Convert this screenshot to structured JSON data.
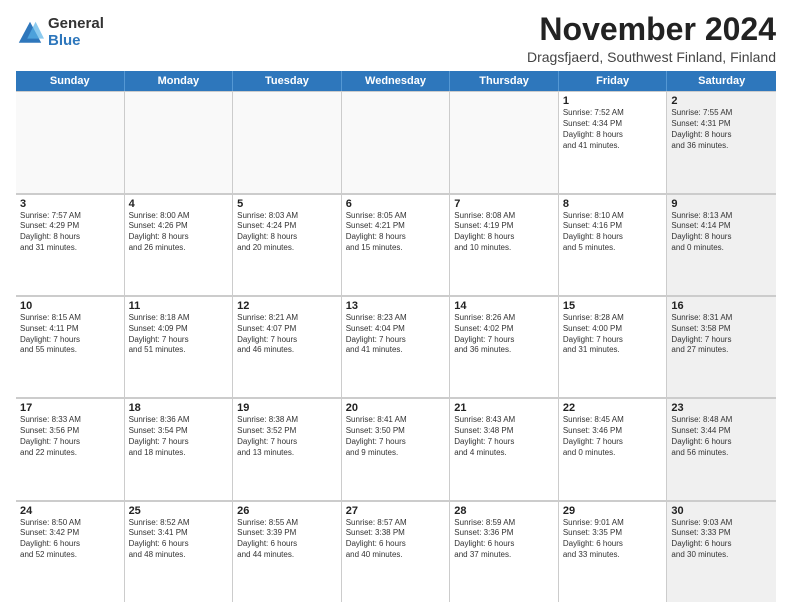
{
  "logo": {
    "general": "General",
    "blue": "Blue"
  },
  "header": {
    "title": "November 2024",
    "subtitle": "Dragsfjaerd, Southwest Finland, Finland"
  },
  "days": [
    "Sunday",
    "Monday",
    "Tuesday",
    "Wednesday",
    "Thursday",
    "Friday",
    "Saturday"
  ],
  "rows": [
    [
      {
        "day": "",
        "info": "",
        "shaded": false,
        "empty": true
      },
      {
        "day": "",
        "info": "",
        "shaded": false,
        "empty": true
      },
      {
        "day": "",
        "info": "",
        "shaded": false,
        "empty": true
      },
      {
        "day": "",
        "info": "",
        "shaded": false,
        "empty": true
      },
      {
        "day": "",
        "info": "",
        "shaded": false,
        "empty": true
      },
      {
        "day": "1",
        "info": "Sunrise: 7:52 AM\nSunset: 4:34 PM\nDaylight: 8 hours\nand 41 minutes.",
        "shaded": false,
        "empty": false
      },
      {
        "day": "2",
        "info": "Sunrise: 7:55 AM\nSunset: 4:31 PM\nDaylight: 8 hours\nand 36 minutes.",
        "shaded": true,
        "empty": false
      }
    ],
    [
      {
        "day": "3",
        "info": "Sunrise: 7:57 AM\nSunset: 4:29 PM\nDaylight: 8 hours\nand 31 minutes.",
        "shaded": false,
        "empty": false
      },
      {
        "day": "4",
        "info": "Sunrise: 8:00 AM\nSunset: 4:26 PM\nDaylight: 8 hours\nand 26 minutes.",
        "shaded": false,
        "empty": false
      },
      {
        "day": "5",
        "info": "Sunrise: 8:03 AM\nSunset: 4:24 PM\nDaylight: 8 hours\nand 20 minutes.",
        "shaded": false,
        "empty": false
      },
      {
        "day": "6",
        "info": "Sunrise: 8:05 AM\nSunset: 4:21 PM\nDaylight: 8 hours\nand 15 minutes.",
        "shaded": false,
        "empty": false
      },
      {
        "day": "7",
        "info": "Sunrise: 8:08 AM\nSunset: 4:19 PM\nDaylight: 8 hours\nand 10 minutes.",
        "shaded": false,
        "empty": false
      },
      {
        "day": "8",
        "info": "Sunrise: 8:10 AM\nSunset: 4:16 PM\nDaylight: 8 hours\nand 5 minutes.",
        "shaded": false,
        "empty": false
      },
      {
        "day": "9",
        "info": "Sunrise: 8:13 AM\nSunset: 4:14 PM\nDaylight: 8 hours\nand 0 minutes.",
        "shaded": true,
        "empty": false
      }
    ],
    [
      {
        "day": "10",
        "info": "Sunrise: 8:15 AM\nSunset: 4:11 PM\nDaylight: 7 hours\nand 55 minutes.",
        "shaded": false,
        "empty": false
      },
      {
        "day": "11",
        "info": "Sunrise: 8:18 AM\nSunset: 4:09 PM\nDaylight: 7 hours\nand 51 minutes.",
        "shaded": false,
        "empty": false
      },
      {
        "day": "12",
        "info": "Sunrise: 8:21 AM\nSunset: 4:07 PM\nDaylight: 7 hours\nand 46 minutes.",
        "shaded": false,
        "empty": false
      },
      {
        "day": "13",
        "info": "Sunrise: 8:23 AM\nSunset: 4:04 PM\nDaylight: 7 hours\nand 41 minutes.",
        "shaded": false,
        "empty": false
      },
      {
        "day": "14",
        "info": "Sunrise: 8:26 AM\nSunset: 4:02 PM\nDaylight: 7 hours\nand 36 minutes.",
        "shaded": false,
        "empty": false
      },
      {
        "day": "15",
        "info": "Sunrise: 8:28 AM\nSunset: 4:00 PM\nDaylight: 7 hours\nand 31 minutes.",
        "shaded": false,
        "empty": false
      },
      {
        "day": "16",
        "info": "Sunrise: 8:31 AM\nSunset: 3:58 PM\nDaylight: 7 hours\nand 27 minutes.",
        "shaded": true,
        "empty": false
      }
    ],
    [
      {
        "day": "17",
        "info": "Sunrise: 8:33 AM\nSunset: 3:56 PM\nDaylight: 7 hours\nand 22 minutes.",
        "shaded": false,
        "empty": false
      },
      {
        "day": "18",
        "info": "Sunrise: 8:36 AM\nSunset: 3:54 PM\nDaylight: 7 hours\nand 18 minutes.",
        "shaded": false,
        "empty": false
      },
      {
        "day": "19",
        "info": "Sunrise: 8:38 AM\nSunset: 3:52 PM\nDaylight: 7 hours\nand 13 minutes.",
        "shaded": false,
        "empty": false
      },
      {
        "day": "20",
        "info": "Sunrise: 8:41 AM\nSunset: 3:50 PM\nDaylight: 7 hours\nand 9 minutes.",
        "shaded": false,
        "empty": false
      },
      {
        "day": "21",
        "info": "Sunrise: 8:43 AM\nSunset: 3:48 PM\nDaylight: 7 hours\nand 4 minutes.",
        "shaded": false,
        "empty": false
      },
      {
        "day": "22",
        "info": "Sunrise: 8:45 AM\nSunset: 3:46 PM\nDaylight: 7 hours\nand 0 minutes.",
        "shaded": false,
        "empty": false
      },
      {
        "day": "23",
        "info": "Sunrise: 8:48 AM\nSunset: 3:44 PM\nDaylight: 6 hours\nand 56 minutes.",
        "shaded": true,
        "empty": false
      }
    ],
    [
      {
        "day": "24",
        "info": "Sunrise: 8:50 AM\nSunset: 3:42 PM\nDaylight: 6 hours\nand 52 minutes.",
        "shaded": false,
        "empty": false
      },
      {
        "day": "25",
        "info": "Sunrise: 8:52 AM\nSunset: 3:41 PM\nDaylight: 6 hours\nand 48 minutes.",
        "shaded": false,
        "empty": false
      },
      {
        "day": "26",
        "info": "Sunrise: 8:55 AM\nSunset: 3:39 PM\nDaylight: 6 hours\nand 44 minutes.",
        "shaded": false,
        "empty": false
      },
      {
        "day": "27",
        "info": "Sunrise: 8:57 AM\nSunset: 3:38 PM\nDaylight: 6 hours\nand 40 minutes.",
        "shaded": false,
        "empty": false
      },
      {
        "day": "28",
        "info": "Sunrise: 8:59 AM\nSunset: 3:36 PM\nDaylight: 6 hours\nand 37 minutes.",
        "shaded": false,
        "empty": false
      },
      {
        "day": "29",
        "info": "Sunrise: 9:01 AM\nSunset: 3:35 PM\nDaylight: 6 hours\nand 33 minutes.",
        "shaded": false,
        "empty": false
      },
      {
        "day": "30",
        "info": "Sunrise: 9:03 AM\nSunset: 3:33 PM\nDaylight: 6 hours\nand 30 minutes.",
        "shaded": true,
        "empty": false
      }
    ]
  ]
}
